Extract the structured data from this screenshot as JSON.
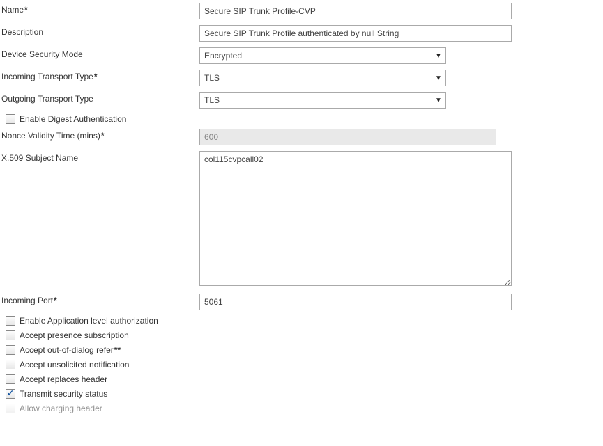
{
  "fields": {
    "name": {
      "label": "Name",
      "required": "*",
      "value": "Secure SIP Trunk Profile-CVP"
    },
    "description": {
      "label": "Description",
      "required": "",
      "value": "Secure SIP Trunk Profile authenticated by null String"
    },
    "deviceSecurityMode": {
      "label": "Device Security Mode",
      "required": "",
      "value": "Encrypted"
    },
    "incomingTransportType": {
      "label": "Incoming Transport Type",
      "required": "*",
      "value": "TLS"
    },
    "outgoingTransportType": {
      "label": "Outgoing Transport Type",
      "required": "",
      "value": "TLS"
    },
    "nonceValidityTime": {
      "label": "Nonce Validity Time (mins)",
      "required": "*",
      "value": "600"
    },
    "x509SubjectName": {
      "label": "X.509 Subject Name",
      "required": "",
      "value": "col115cvpcall02"
    },
    "incomingPort": {
      "label": "Incoming Port",
      "required": "*",
      "value": "5061"
    }
  },
  "checkboxes": {
    "enableDigestAuth": {
      "label": "Enable Digest Authentication",
      "checked": false,
      "suffix": ""
    },
    "enableAppLevelAuth": {
      "label": "Enable Application level authorization",
      "checked": false,
      "suffix": ""
    },
    "acceptPresenceSub": {
      "label": "Accept presence subscription",
      "checked": false,
      "suffix": ""
    },
    "acceptOutOfDialogRefer": {
      "label": "Accept out-of-dialog refer",
      "checked": false,
      "suffix": "**"
    },
    "acceptUnsolicitedNotif": {
      "label": "Accept unsolicited notification",
      "checked": false,
      "suffix": ""
    },
    "acceptReplacesHeader": {
      "label": "Accept replaces header",
      "checked": false,
      "suffix": ""
    },
    "transmitSecurityStatus": {
      "label": "Transmit security status",
      "checked": true,
      "suffix": ""
    },
    "allowChargingHeader": {
      "label": "Allow charging header",
      "checked": false,
      "suffix": ""
    }
  }
}
